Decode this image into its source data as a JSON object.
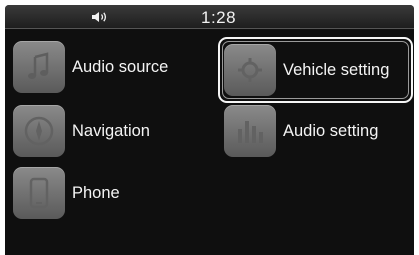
{
  "status_bar": {
    "clock": "1:28",
    "volume_icon": "speaker-volume-icon"
  },
  "menu": {
    "items": [
      {
        "label": "Audio source",
        "icon": "music-note-icon"
      },
      {
        "label": "Vehicle setting",
        "icon": "car-gear-icon",
        "selected": true
      },
      {
        "label": "Navigation",
        "icon": "compass-icon"
      },
      {
        "label": "Audio setting",
        "icon": "equalizer-icon"
      },
      {
        "label": "Phone",
        "icon": "phone-icon"
      }
    ]
  },
  "colors": {
    "background": "#0f0f0f",
    "tile": "#707070",
    "text": "#f4f4f4",
    "frame": "#ffffff"
  }
}
